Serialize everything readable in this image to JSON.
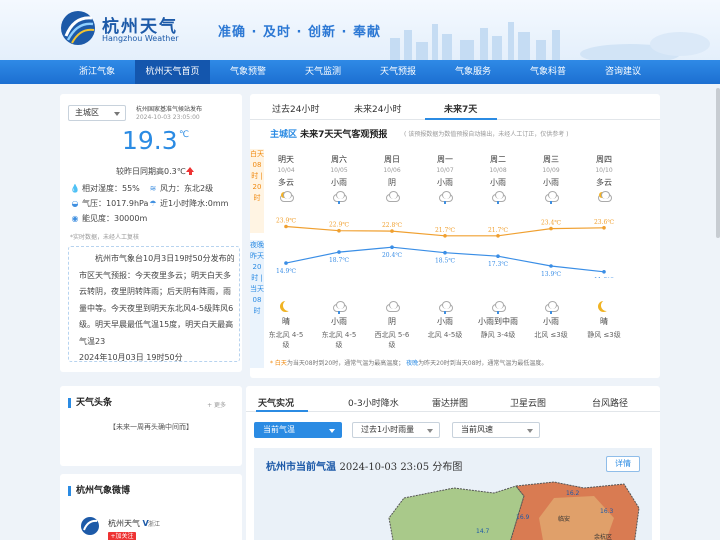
{
  "header": {
    "brand_cn": "杭州天气",
    "brand_en": "Hangzhou Weather",
    "slogan": "准确 · 及时 · 创新 · 奉献"
  },
  "nav": {
    "items": [
      {
        "label": "浙江气象"
      },
      {
        "label": "杭州天气首页"
      },
      {
        "label": "气象预警"
      },
      {
        "label": "天气监测"
      },
      {
        "label": "天气预报"
      },
      {
        "label": "气象服务"
      },
      {
        "label": "气象科普"
      },
      {
        "label": "咨询建议"
      }
    ],
    "active_index": 1
  },
  "current": {
    "district": "主城区",
    "source": "杭州国家基准气候站发布",
    "time": "2024-10-03 23:05:00",
    "temperature": "19.3",
    "unit": "℃",
    "compare": "较昨日同期高0.3℃",
    "humidity": "相对湿度：55%",
    "wind": "风力：东北2级",
    "pressure": "气压：1017.9hPa",
    "rain": "近1小时降水:0mm",
    "visibility": "能见度：30000m",
    "note": "*实时数据，未经人工复核",
    "bulletin": "杭州市气象台10月3日19时50分发布的市区天气预报：今天夜里多云；明天白天多云转阴，夜里阴转阵雨；后天阴有阵雨，雨量中等。今天夜里到明天东北风4-5级阵风6级。明天早晨最低气温15度，明天白天最高气温23",
    "bulletin_date": "2024年10月03日 19时50分"
  },
  "forecast": {
    "tabs": [
      "过去24小时",
      "未来24小时",
      "未来7天"
    ],
    "active_tab": 2,
    "title_district": "主城区",
    "title_main": "未来7天天气客观预报",
    "subtitle": "( 该预报数据为数值预报自动输出，未经人工订正，仅供参考 )",
    "day_label": "白天 08时 | 20时",
    "night_label": "夜晚 昨天20时 | 当天08时",
    "days": [
      {
        "week": "明天",
        "date": "10/04",
        "day_weather": "多云",
        "day_icon": "partly-cloudy-icon",
        "night_weather": "晴",
        "night_icon": "moon-icon",
        "wind": "东北风 4-5级"
      },
      {
        "week": "周六",
        "date": "10/05",
        "day_weather": "小雨",
        "day_icon": "light-rain-icon",
        "night_weather": "小雨",
        "night_icon": "light-rain-icon",
        "wind": "东北风 4-5级"
      },
      {
        "week": "周日",
        "date": "10/06",
        "day_weather": "阴",
        "day_icon": "overcast-icon",
        "night_weather": "阴",
        "night_icon": "overcast-icon",
        "wind": "西北风 5-6级"
      },
      {
        "week": "周一",
        "date": "10/07",
        "day_weather": "小雨",
        "day_icon": "light-rain-icon",
        "night_weather": "小雨",
        "night_icon": "light-rain-icon",
        "wind": "北风 4-5级"
      },
      {
        "week": "周二",
        "date": "10/08",
        "day_weather": "小雨",
        "day_icon": "light-rain-icon",
        "night_weather": "小雨到中雨",
        "night_icon": "light-rain-icon",
        "wind": "静风 3-4级"
      },
      {
        "week": "周三",
        "date": "10/09",
        "day_weather": "小雨",
        "day_icon": "light-rain-icon",
        "night_weather": "小雨",
        "night_icon": "light-rain-icon",
        "wind": "北风 ≤3级"
      },
      {
        "week": "周四",
        "date": "10/10",
        "day_weather": "多云",
        "day_icon": "partly-cloudy-icon",
        "night_weather": "晴",
        "night_icon": "moon-icon",
        "wind": "静风 ≤3级"
      }
    ],
    "high_labels": [
      "23.9℃",
      "22.9℃",
      "22.8℃",
      "21.7℃",
      "21.7℃",
      "23.4℃",
      "23.6℃"
    ],
    "low_labels": [
      "14.9℃",
      "18.7℃",
      "20.4℃",
      "18.5℃",
      "17.3℃",
      "13.9℃",
      "11.9℃"
    ],
    "legend_day": "* 白天",
    "legend_day_text": "为当天08时到20时，通常气温为最高温度；",
    "legend_night": "夜晚",
    "legend_night_text": "为昨天20时到当天08时，通常气温为最低温度。",
    "colors": {
      "high": "#f0a030",
      "low": "#3a8ee6"
    }
  },
  "chart_data": {
    "type": "line",
    "x": [
      "10/04",
      "10/05",
      "10/06",
      "10/07",
      "10/08",
      "10/09",
      "10/10"
    ],
    "series": [
      {
        "values": [
          23.9,
          22.9,
          22.8,
          21.7,
          21.7,
          23.4,
          23.6
        ]
      },
      {
        "values": [
          14.9,
          18.7,
          20.4,
          18.5,
          17.3,
          13.9,
          11.9
        ]
      }
    ],
    "title": "",
    "xlabel": "",
    "ylabel": "",
    "grid": false
  },
  "news": {
    "title": "天气头条",
    "more": "+ 更多",
    "item": "【未来一周再头确中间而】"
  },
  "weibo": {
    "title": "杭州气象微博",
    "name": "杭州天气",
    "verified": "V",
    "location": "浙江",
    "follow": "+加关注"
  },
  "map": {
    "tabs": [
      "天气实况",
      "0-3小时降水",
      "雷达拼图",
      "卫星云图",
      "台风路径"
    ],
    "active_tab": 0,
    "select1": "当前气温",
    "select2": "过去1小时雨量",
    "select3": "当前风速",
    "title": "杭州市当前气温",
    "title_time": "2024-10-03 23:05 分布图",
    "detail": "详情",
    "stations": [
      "16.2",
      "16.3",
      "16.9",
      "14.7",
      "临安",
      "余杭区"
    ]
  }
}
